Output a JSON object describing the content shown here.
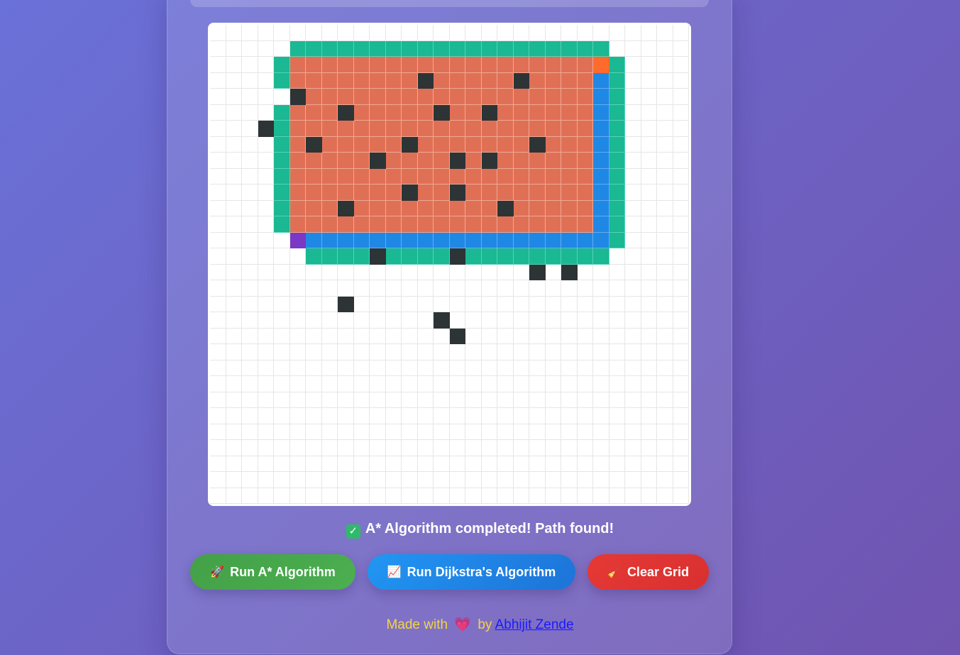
{
  "status": {
    "icon": "check-mark-icon",
    "icon_glyph": "✓",
    "text": "A* Algorithm completed! Path found!"
  },
  "buttons": {
    "astar": {
      "icon": "rocket-icon",
      "glyph": "🚀",
      "label": "Run A* Algorithm"
    },
    "dijkstra": {
      "icon": "chart-increasing-icon",
      "glyph": "📈",
      "label": "Run Dijkstra's Algorithm"
    },
    "clear": {
      "icon": "broom-icon",
      "glyph": "🧹",
      "label": "Clear Grid"
    }
  },
  "footer": {
    "prefix": "Made with",
    "heart": "💗",
    "by": "by",
    "author": "Abhijit Zende"
  },
  "colors": {
    "visited": "#e07055",
    "frontier": "#1ab893",
    "path": "#1f88e5",
    "wall": "#2d3436",
    "start": "#7a38c4",
    "end": "#ff6b2c"
  },
  "grid": {
    "rows": 30,
    "cols": 30,
    "start": [
      13,
      5
    ],
    "end": [
      2,
      24
    ],
    "walls": [
      [
        3,
        13
      ],
      [
        3,
        19
      ],
      [
        4,
        5
      ],
      [
        5,
        8
      ],
      [
        5,
        14
      ],
      [
        5,
        17
      ],
      [
        6,
        3
      ],
      [
        7,
        6
      ],
      [
        7,
        12
      ],
      [
        7,
        20
      ],
      [
        8,
        10
      ],
      [
        8,
        15
      ],
      [
        8,
        17
      ],
      [
        10,
        12
      ],
      [
        10,
        15
      ],
      [
        11,
        8
      ],
      [
        11,
        18
      ],
      [
        14,
        10
      ],
      [
        14,
        15
      ],
      [
        15,
        20
      ],
      [
        15,
        22
      ],
      [
        17,
        8
      ],
      [
        18,
        14
      ],
      [
        19,
        15
      ]
    ]
  }
}
